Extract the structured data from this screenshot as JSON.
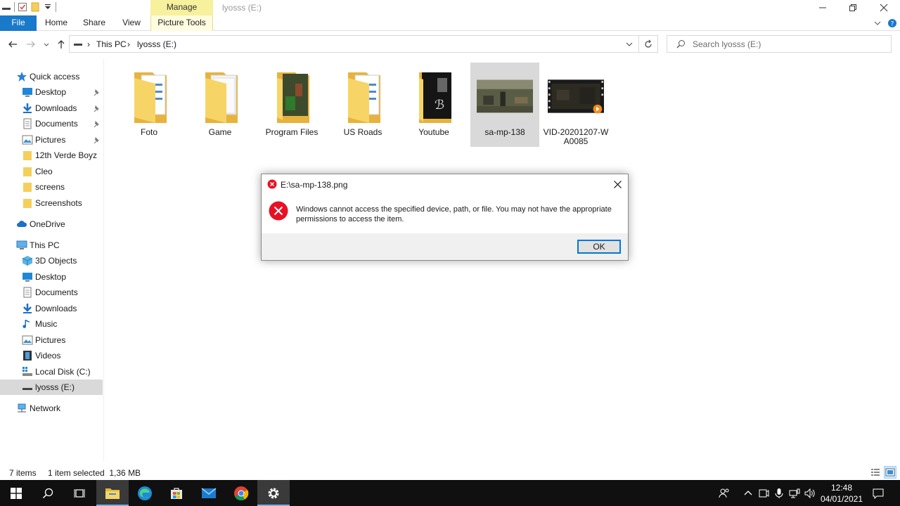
{
  "window": {
    "title": "lyosss (E:)",
    "contextual_tab": "Manage"
  },
  "ribbon": {
    "tabs": [
      "File",
      "Home",
      "Share",
      "View",
      "Picture Tools"
    ]
  },
  "address": {
    "crumbs": [
      "This PC",
      "lyosss (E:)"
    ],
    "search_placeholder": "Search lyosss (E:)"
  },
  "nav": {
    "quick_access": "Quick access",
    "quick_items": [
      "Desktop",
      "Downloads",
      "Documents",
      "Pictures",
      "12th Verde Boyz",
      "Cleo",
      "screens",
      "Screenshots"
    ],
    "onedrive": "OneDrive",
    "this_pc": "This PC",
    "pc_items": [
      "3D Objects",
      "Desktop",
      "Documents",
      "Downloads",
      "Music",
      "Pictures",
      "Videos",
      "Local Disk (C:)",
      "lyosss (E:)"
    ],
    "network": "Network"
  },
  "files": [
    {
      "name": "Foto",
      "kind": "folder"
    },
    {
      "name": "Game",
      "kind": "folder"
    },
    {
      "name": "Program Files",
      "kind": "folder"
    },
    {
      "name": "US Roads",
      "kind": "folder"
    },
    {
      "name": "Youtube",
      "kind": "folder"
    },
    {
      "name": "sa-mp-138",
      "kind": "image"
    },
    {
      "name": "VID-20201207-WA0085",
      "kind": "video"
    }
  ],
  "dialog": {
    "title": "E:\\sa-mp-138.png",
    "message": "Windows cannot access the specified device, path, or file. You may not have the appropriate permissions to access the item.",
    "ok": "OK"
  },
  "status": {
    "count": "7 items",
    "selection": "1 item selected  1,36 MB"
  },
  "taskbar": {
    "time": "12:48",
    "date": "04/01/2021"
  },
  "colors": {
    "accent": "#1979ca",
    "manage": "#f7f09d",
    "error": "#e81123",
    "folder": "#f5cf5b"
  }
}
